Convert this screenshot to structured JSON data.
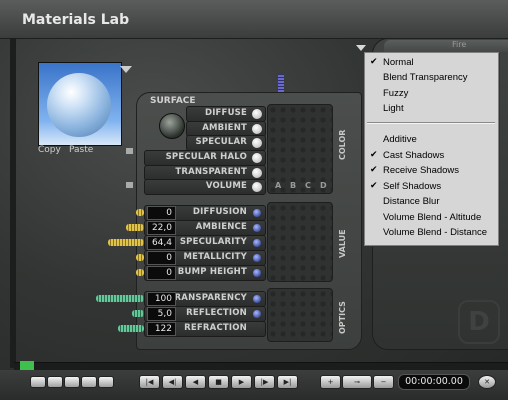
{
  "window": {
    "title": "Materials Lab"
  },
  "preview": {
    "copy_label": "Copy",
    "paste_label": "Paste"
  },
  "panel": {
    "surface_label": "SURFACE",
    "surface_rows": [
      {
        "label": "DIFFUSE"
      },
      {
        "label": "AMBIENT"
      },
      {
        "label": "SPECULAR"
      },
      {
        "label": "SPECULAR HALO"
      },
      {
        "label": "TRANSPARENT"
      },
      {
        "label": "VOLUME"
      }
    ],
    "value_rows": [
      {
        "label": "DIFFUSION",
        "value": "0"
      },
      {
        "label": "AMBIENCE",
        "value": "22,0"
      },
      {
        "label": "SPECULARITY",
        "value": "64,4"
      },
      {
        "label": "METALLICITY",
        "value": "0"
      },
      {
        "label": "BUMP HEIGHT",
        "value": "0"
      }
    ],
    "optics_rows": [
      {
        "label": "TRANSPARENCY",
        "value": "100"
      },
      {
        "label": "REFLECTION",
        "value": "5,0"
      },
      {
        "label": "REFRACTION",
        "value": "122"
      }
    ],
    "section_labels": {
      "color": "COLOR",
      "value": "VALUE",
      "optics": "OPTICS"
    },
    "columns": [
      "A",
      "B",
      "C",
      "D"
    ]
  },
  "fire_label": "Fire",
  "dropdown": {
    "group1": [
      {
        "label": "Normal",
        "checked": "✔"
      },
      {
        "label": "Blend Transparency",
        "checked": ""
      },
      {
        "label": "Fuzzy",
        "checked": ""
      },
      {
        "label": "Light",
        "checked": ""
      }
    ],
    "group2": [
      {
        "label": "Additive",
        "checked": ""
      },
      {
        "label": "Cast Shadows",
        "checked": "✔"
      },
      {
        "label": "Receive Shadows",
        "checked": "✔"
      },
      {
        "label": "Self Shadows",
        "checked": "✔"
      },
      {
        "label": "Distance Blur",
        "checked": ""
      },
      {
        "label": "Volume Blend - Altitude",
        "checked": ""
      },
      {
        "label": "Volume Blend - Distance",
        "checked": ""
      }
    ]
  },
  "transport": {
    "time": "00:00:00.00",
    "buttons": [
      "|◀",
      "◀|",
      "◀",
      "■",
      "▶",
      "|▶",
      "▶|"
    ],
    "plus_label": "+",
    "key_label": "⊸",
    "minus_label": "−",
    "close_label": "✕"
  },
  "colors": {
    "accent_slider_yellow": "#e1c44a",
    "accent_slider_green": "#66c89a",
    "timeline_marker": "#3fbf4c"
  },
  "side_letter": "D"
}
